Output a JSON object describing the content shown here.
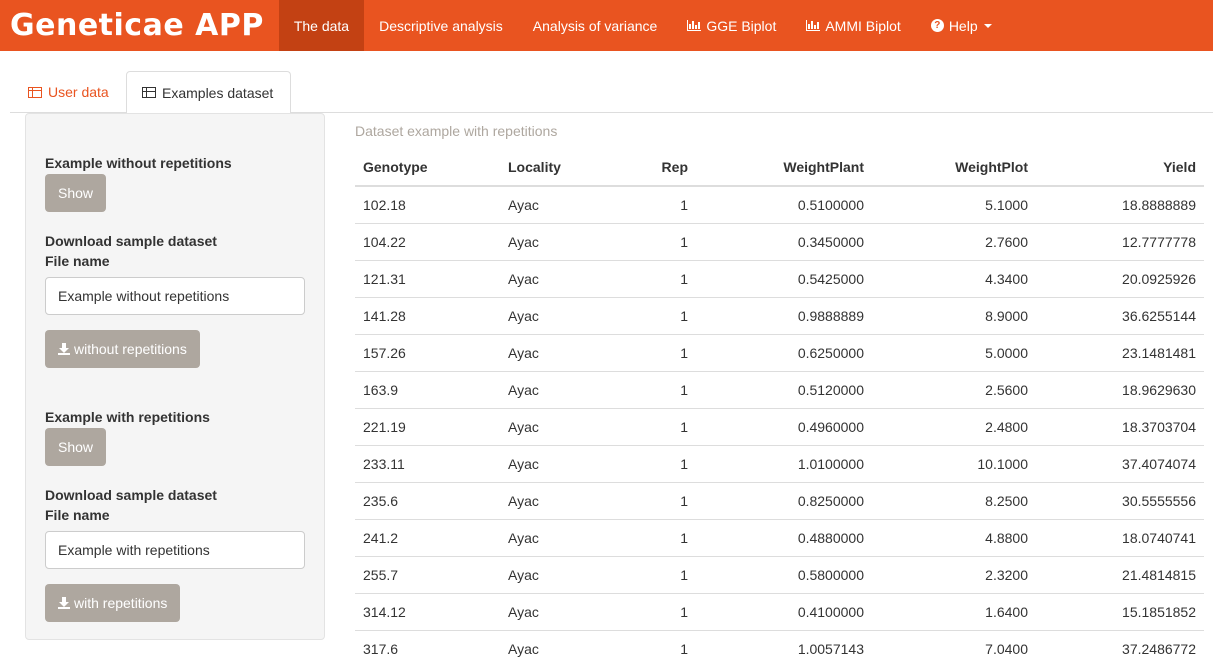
{
  "navbar": {
    "brand": "Geneticae APP",
    "items": [
      {
        "label": "The data",
        "icon": ""
      },
      {
        "label": "Descriptive analysis",
        "icon": ""
      },
      {
        "label": "Analysis of variance",
        "icon": ""
      },
      {
        "label": "GGE Biplot",
        "icon": "bar-chart-icon"
      },
      {
        "label": "AMMI Biplot",
        "icon": "bar-chart-icon"
      },
      {
        "label": "Help",
        "icon": "question-circle-icon"
      }
    ],
    "accent": "#e95420",
    "active_bg": "#c34113"
  },
  "tabs": [
    {
      "label": "User data",
      "icon": "table-icon"
    },
    {
      "label": "Examples dataset",
      "icon": "table-icon"
    }
  ],
  "sidebar": {
    "without": {
      "title": "Example without repetitions",
      "show_label": "Show",
      "download_label": "Download sample dataset",
      "file_label": "File name",
      "file_value": "Example without repetitions",
      "button_label": "without repetitions"
    },
    "with": {
      "title": "Example with repetitions",
      "show_label": "Show",
      "download_label": "Download sample dataset",
      "file_label": "File name",
      "file_value": "Example with repetitions",
      "button_label": "with repetitions"
    },
    "button_color": "#aea79f"
  },
  "table": {
    "caption": "Dataset example with repetitions",
    "headers": [
      "Genotype",
      "Locality",
      "Rep",
      "WeightPlant",
      "WeightPlot",
      "Yield"
    ],
    "rows": [
      [
        "102.18",
        "Ayac",
        "1",
        "0.5100000",
        "5.1000",
        "18.8888889"
      ],
      [
        "104.22",
        "Ayac",
        "1",
        "0.3450000",
        "2.7600",
        "12.7777778"
      ],
      [
        "121.31",
        "Ayac",
        "1",
        "0.5425000",
        "4.3400",
        "20.0925926"
      ],
      [
        "141.28",
        "Ayac",
        "1",
        "0.9888889",
        "8.9000",
        "36.6255144"
      ],
      [
        "157.26",
        "Ayac",
        "1",
        "0.6250000",
        "5.0000",
        "23.1481481"
      ],
      [
        "163.9",
        "Ayac",
        "1",
        "0.5120000",
        "2.5600",
        "18.9629630"
      ],
      [
        "221.19",
        "Ayac",
        "1",
        "0.4960000",
        "2.4800",
        "18.3703704"
      ],
      [
        "233.11",
        "Ayac",
        "1",
        "1.0100000",
        "10.1000",
        "37.4074074"
      ],
      [
        "235.6",
        "Ayac",
        "1",
        "0.8250000",
        "8.2500",
        "30.5555556"
      ],
      [
        "241.2",
        "Ayac",
        "1",
        "0.4880000",
        "4.8800",
        "18.0740741"
      ],
      [
        "255.7",
        "Ayac",
        "1",
        "0.5800000",
        "2.3200",
        "21.4814815"
      ],
      [
        "314.12",
        "Ayac",
        "1",
        "0.4100000",
        "1.6400",
        "15.1851852"
      ],
      [
        "317.6",
        "Ayac",
        "1",
        "1.0057143",
        "7.0400",
        "37.2486772"
      ]
    ]
  }
}
